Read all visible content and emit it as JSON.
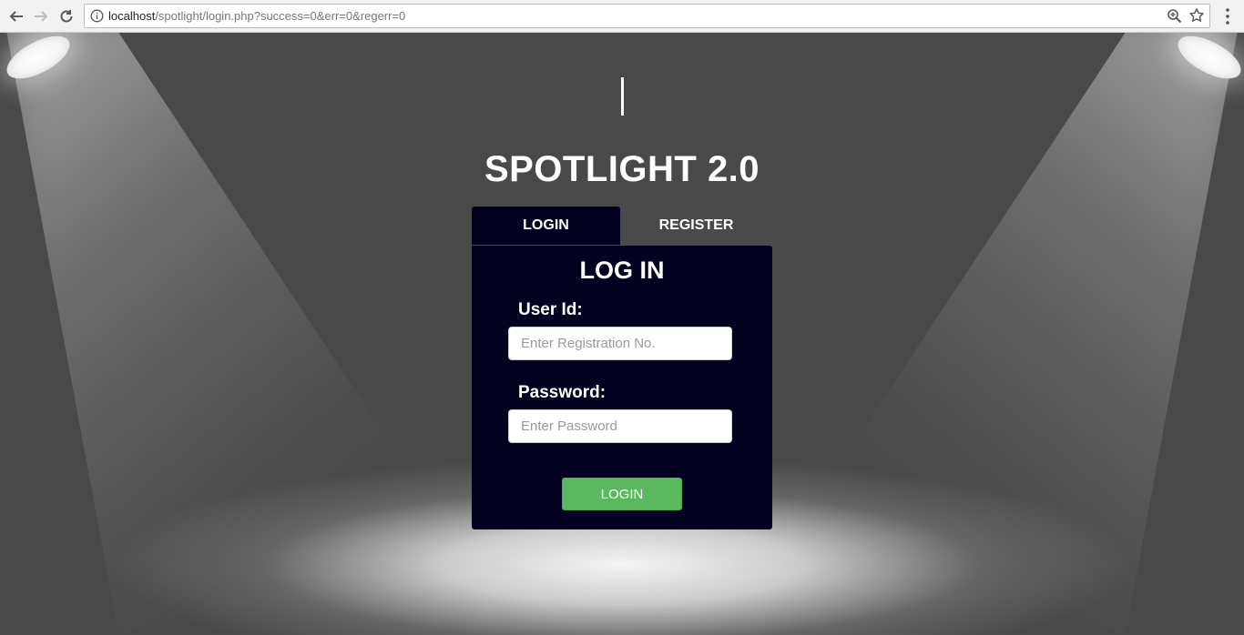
{
  "browser": {
    "url_host": "localhost",
    "url_path": "/spotlight/login.php?success=0&err=0&regerr=0",
    "icons": {
      "back": "back-arrow-icon",
      "forward": "forward-arrow-icon",
      "reload": "reload-icon",
      "info": "info-icon",
      "zoom": "zoom-icon",
      "bookmark": "star-icon",
      "menu": "kebab-menu-icon"
    }
  },
  "page": {
    "title": "SPOTLIGHT 2.0",
    "tabs": [
      {
        "label": "LOGIN",
        "active": true
      },
      {
        "label": "REGISTER",
        "active": false
      }
    ],
    "form": {
      "heading": "LOG IN",
      "user_label": "User Id:",
      "user_placeholder": "Enter Registration No.",
      "user_value": "",
      "password_label": "Password:",
      "password_placeholder": "Enter Password",
      "password_value": "",
      "submit_label": "LOGIN"
    }
  },
  "colors": {
    "panel_bg": "#020220",
    "button_green": "#5cb85c",
    "stage_bg": "#4a4949"
  }
}
